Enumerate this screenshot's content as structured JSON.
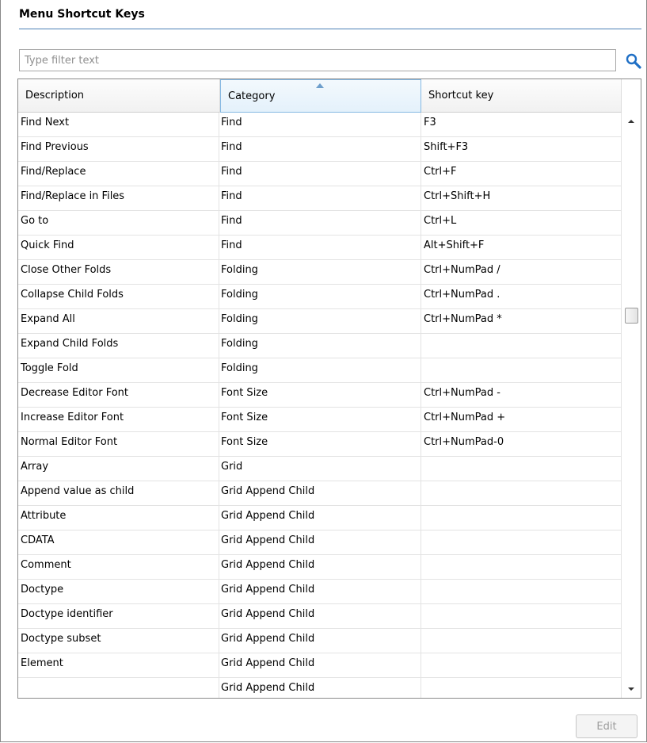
{
  "section": {
    "title": "Menu Shortcut Keys"
  },
  "filter": {
    "placeholder": "Type filter text",
    "value": ""
  },
  "table": {
    "columns": [
      "Description",
      "Category",
      "Shortcut key"
    ],
    "sorted_column": "Category",
    "rows": [
      [
        "Find Next",
        "Find",
        "F3"
      ],
      [
        "Find Previous",
        "Find",
        "Shift+F3"
      ],
      [
        "Find/Replace",
        "Find",
        "Ctrl+F"
      ],
      [
        "Find/Replace in Files",
        "Find",
        "Ctrl+Shift+H"
      ],
      [
        "Go to",
        "Find",
        "Ctrl+L"
      ],
      [
        "Quick Find",
        "Find",
        "Alt+Shift+F"
      ],
      [
        "Close Other Folds",
        "Folding",
        "Ctrl+NumPad /"
      ],
      [
        "Collapse Child Folds",
        "Folding",
        "Ctrl+NumPad ."
      ],
      [
        "Expand All",
        "Folding",
        "Ctrl+NumPad *"
      ],
      [
        "Expand Child Folds",
        "Folding",
        ""
      ],
      [
        "Toggle Fold",
        "Folding",
        ""
      ],
      [
        "Decrease Editor Font",
        "Font Size",
        "Ctrl+NumPad -"
      ],
      [
        "Increase Editor Font",
        "Font Size",
        "Ctrl+NumPad +"
      ],
      [
        "Normal Editor Font",
        "Font Size",
        "Ctrl+NumPad-0"
      ],
      [
        "Array",
        "Grid",
        ""
      ],
      [
        "Append value as child",
        "Grid Append Child",
        ""
      ],
      [
        "Attribute",
        "Grid Append Child",
        ""
      ],
      [
        "CDATA",
        "Grid Append Child",
        ""
      ],
      [
        "Comment",
        "Grid Append Child",
        ""
      ],
      [
        "Doctype",
        "Grid Append Child",
        ""
      ],
      [
        "Doctype identifier",
        "Grid Append Child",
        ""
      ],
      [
        "Doctype subset",
        "Grid Append Child",
        ""
      ],
      [
        "Element",
        "Grid Append Child",
        ""
      ],
      [
        "",
        "Grid Append Child",
        ""
      ]
    ]
  },
  "buttons": {
    "edit": "Edit"
  },
  "colors": {
    "accent_rule": "#4d81b6",
    "sorted_header": "#e4f1fb",
    "search_icon": "#1f6fc5"
  },
  "icons": {
    "search": "search-icon",
    "sort": "sort-ascending-icon",
    "scroll_up": "scroll-up-arrow-icon",
    "scroll_down": "scroll-down-arrow-icon"
  }
}
